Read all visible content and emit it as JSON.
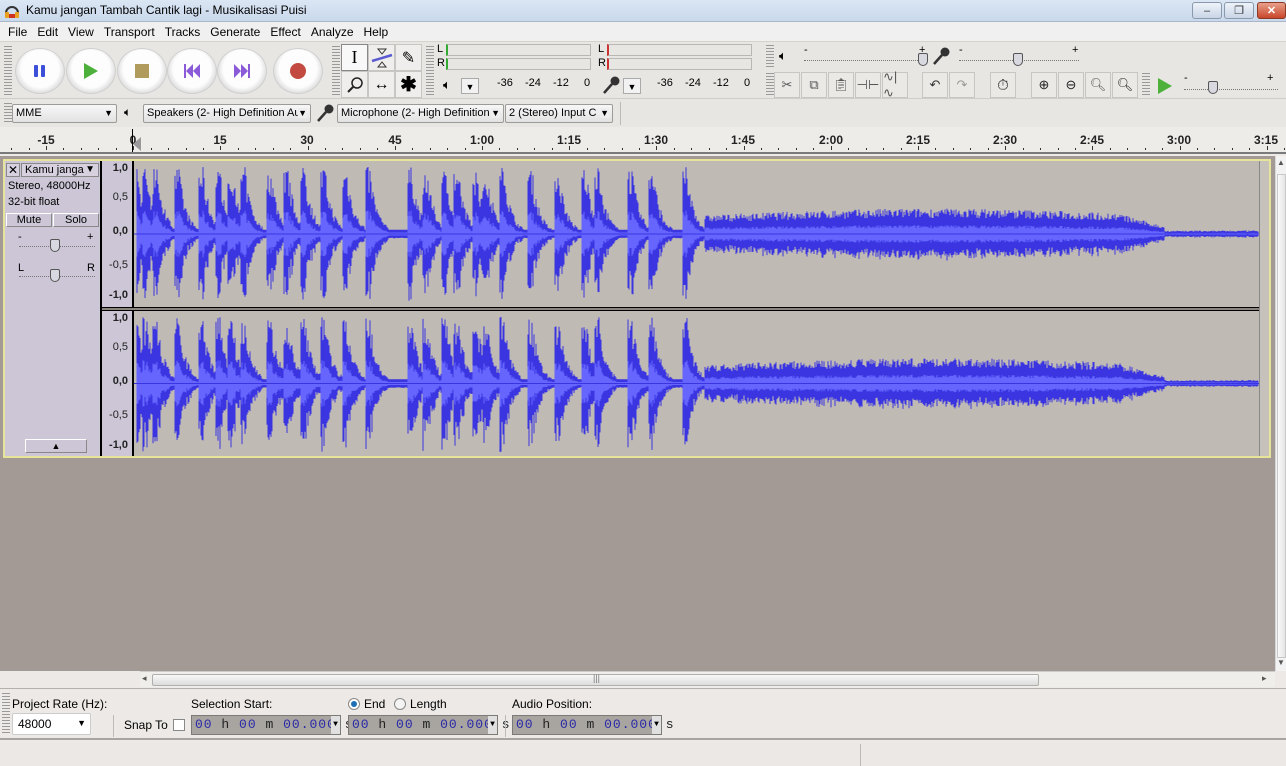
{
  "window": {
    "title": "Kamu jangan Tambah Cantik lagi - Musikalisasi Puisi",
    "controls": {
      "minimize": "–",
      "maximize": "❐",
      "close": "✕"
    }
  },
  "menu": [
    "File",
    "Edit",
    "View",
    "Transport",
    "Tracks",
    "Generate",
    "Effect",
    "Analyze",
    "Help"
  ],
  "transport": {
    "buttons": [
      {
        "name": "pause",
        "icon": "pause-icon",
        "color": "#3b4fd8"
      },
      {
        "name": "play",
        "icon": "play-icon",
        "color": "#4cb03a"
      },
      {
        "name": "stop",
        "icon": "stop-icon",
        "color": "#b09a5c"
      },
      {
        "name": "skip-to-start",
        "icon": "skip-start-icon",
        "color": "#8a5ad8"
      },
      {
        "name": "skip-to-end",
        "icon": "skip-end-icon",
        "color": "#8a5ad8"
      },
      {
        "name": "record",
        "icon": "record-icon",
        "color": "#c24a40"
      }
    ]
  },
  "tools": [
    "selection-tool",
    "envelope-tool",
    "draw-tool",
    "zoom-tool",
    "time-shift-tool",
    "multi-tool"
  ],
  "meters": {
    "playback": {
      "channels": [
        "L",
        "R"
      ],
      "scale": [
        "-36",
        "-24",
        "-12",
        "0"
      ]
    },
    "recording": {
      "channels": [
        "L",
        "R"
      ],
      "scale": [
        "-36",
        "-24",
        "-12",
        "0"
      ]
    }
  },
  "mixer": {
    "output_volume": {
      "min_label": "-",
      "max_label": "+",
      "value": 1.0
    },
    "input_volume": {
      "min_label": "-",
      "max_label": "+",
      "value": 0.5
    }
  },
  "edit_toolbar": [
    "cut",
    "copy",
    "paste",
    "trim",
    "silence",
    "undo",
    "redo",
    "sync-lock",
    "zoom-in",
    "zoom-out",
    "fit-selection",
    "fit-project"
  ],
  "play_at_speed": {
    "min_label": "-",
    "max_label": "+",
    "value": 0.25
  },
  "devices": {
    "host": "MME",
    "output": "Speakers (2- High Definition Au",
    "input": "Microphone (2- High Definition",
    "channels": "2 (Stereo) Input C"
  },
  "ruler": {
    "labels": [
      "-15",
      "0",
      "15",
      "30",
      "45",
      "1:00",
      "1:15",
      "1:30",
      "1:45",
      "2:00",
      "2:15",
      "2:30",
      "2:45",
      "3:00",
      "3:15"
    ]
  },
  "track": {
    "name": "Kamu janga",
    "info_line1": "Stereo, 48000Hz",
    "info_line2": "32-bit float",
    "mute_label": "Mute",
    "solo_label": "Solo",
    "gain": {
      "min_label": "-",
      "max_label": "+",
      "value": 0.5
    },
    "pan": {
      "min_label": "L",
      "max_label": "R",
      "value": 0.5
    },
    "scale_labels": [
      "1,0",
      "0,5",
      "0,0",
      "-0,5",
      "-1,0"
    ],
    "wave_color": "#3a35e0",
    "wave_rms_color": "#6666ff"
  },
  "selection_bar": {
    "project_rate_label": "Project Rate (Hz):",
    "project_rate": "48000",
    "snap_to_label": "Snap To",
    "snap_to_checked": false,
    "selection_start_label": "Selection Start:",
    "end_label": "End",
    "length_label": "Length",
    "end_selected": true,
    "audio_position_label": "Audio Position:",
    "selection_start": {
      "h": "00",
      "m": "00",
      "s": "00.000"
    },
    "selection_end": {
      "h": "00",
      "m": "00",
      "s": "00.000"
    },
    "audio_position": {
      "h": "00",
      "m": "00",
      "s": "00.000"
    },
    "unit_h": "h",
    "unit_m": "m",
    "unit_s": "s"
  }
}
